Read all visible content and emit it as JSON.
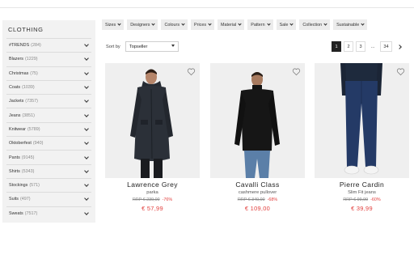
{
  "sidebar": {
    "title": "CLOTHING",
    "items": [
      {
        "label": "#TRENDS",
        "count": "(284)"
      },
      {
        "label": "Blazers",
        "count": "(1229)"
      },
      {
        "label": "Christmas",
        "count": "(75)"
      },
      {
        "label": "Coats",
        "count": "(1039)"
      },
      {
        "label": "Jackets",
        "count": "(7357)"
      },
      {
        "label": "Jeans",
        "count": "(3851)"
      },
      {
        "label": "Knitwear",
        "count": "(5789)"
      },
      {
        "label": "Oktoberfest",
        "count": "(940)"
      },
      {
        "label": "Pants",
        "count": "(9145)"
      },
      {
        "label": "Shirts",
        "count": "(5343)"
      },
      {
        "label": "Stockings",
        "count": "(571)"
      },
      {
        "label": "Suits",
        "count": "(497)"
      },
      {
        "label": "Sweats",
        "count": "(7517)"
      }
    ]
  },
  "filters": [
    "Sizes",
    "Designers",
    "Colours",
    "Prices",
    "Material",
    "Pattern",
    "Sale",
    "Collection",
    "Sustainable"
  ],
  "sort": {
    "label": "Sort by",
    "value": "Topseller"
  },
  "pagination": {
    "pages": [
      "1",
      "2",
      "3",
      "...",
      "34"
    ],
    "active": "1"
  },
  "products": [
    {
      "brand": "Lawrence Grey",
      "type": "parka",
      "rrp": "RRP € 239,00",
      "discount": "-76%",
      "price": "€ 57,99"
    },
    {
      "brand": "Cavalli Class",
      "type": "cashmere pullover",
      "rrp": "RRP € 340,00",
      "discount": "-68%",
      "price": "€ 109,00"
    },
    {
      "brand": "Pierre Cardin",
      "type": "Slim Fit jeans",
      "rrp": "RRP € 99,99",
      "discount": "-60%",
      "price": "€ 39,99"
    }
  ],
  "colors": {
    "sale": "#e2403e",
    "sidebar_bg": "#f2f2f2",
    "filter_bg": "#ececec",
    "active_page": "#222222"
  }
}
